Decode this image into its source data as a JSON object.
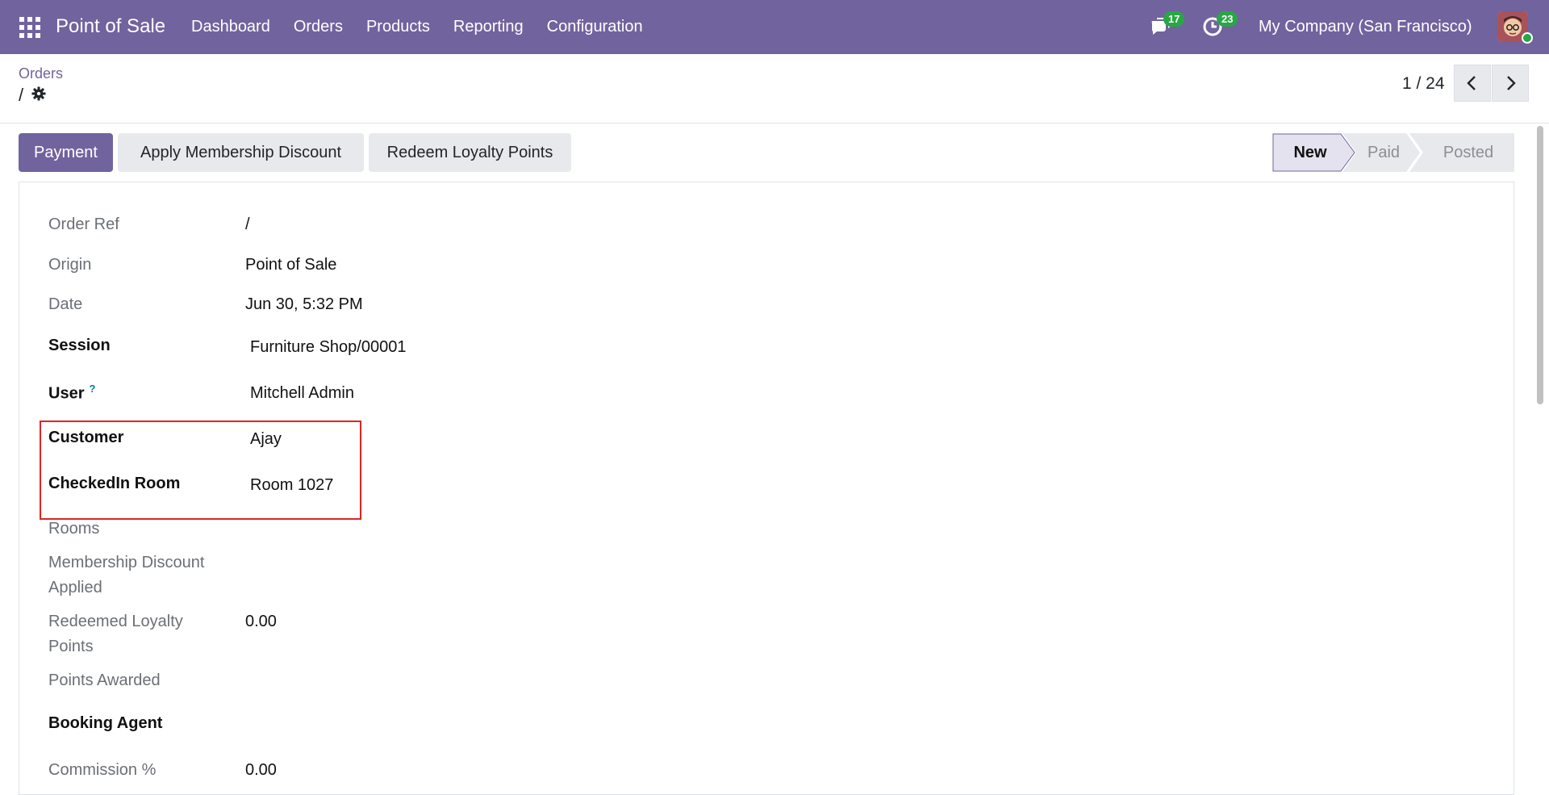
{
  "navbar": {
    "app_name": "Point of Sale",
    "menu": [
      "Dashboard",
      "Orders",
      "Products",
      "Reporting",
      "Configuration"
    ],
    "messages_count": "17",
    "activities_count": "23",
    "company": "My Company (San Francisco)",
    "accent_color": "#71639e"
  },
  "breadcrumb": {
    "parent": "Orders",
    "current": "/"
  },
  "pager": {
    "value": "1 / 24"
  },
  "actions": {
    "payment": "Payment",
    "membership": "Apply Membership Discount",
    "loyalty": "Redeem Loyalty Points"
  },
  "status": {
    "stages": [
      "New",
      "Paid",
      "Posted"
    ],
    "current": "New"
  },
  "form": {
    "order_ref_label": "Order Ref",
    "order_ref_value": "/",
    "origin_label": "Origin",
    "origin_value": "Point of Sale",
    "date_label": "Date",
    "date_value": "Jun 30, 5:32 PM",
    "session_label": "Session",
    "session_value": "Furniture Shop/00001",
    "user_label": "User",
    "user_help": "?",
    "user_value": "Mitchell Admin",
    "customer_label": "Customer",
    "customer_value": "Ajay",
    "room_label": "CheckedIn Room",
    "room_value": "Room 1027",
    "rooms_label": "Rooms",
    "membership_label_1": "Membership Discount",
    "membership_label_2": "Applied",
    "loyalty_label_1": "Redeemed Loyalty",
    "loyalty_label_2": "Points",
    "loyalty_value": "0.00",
    "points_label": "Points Awarded",
    "booking_label": "Booking Agent",
    "commission_label": "Commission %",
    "commission_value": "0.00"
  }
}
